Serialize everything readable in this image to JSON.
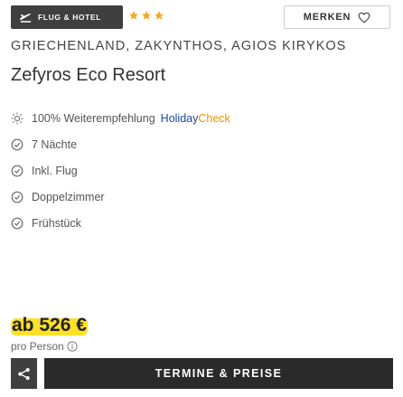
{
  "badge": {
    "label": "FLUG & HOTEL",
    "icon": "airplane-hotel-icon"
  },
  "rating": {
    "stars": 3,
    "color": "#f5a623"
  },
  "merken": {
    "label": "MERKEN",
    "icon": "heart-outline-icon"
  },
  "location": "GRIECHENLAND, ZAKYNTHOS, AGIOS KIRYKOS",
  "hotel_name": "Zefyros Eco Resort",
  "recommendation": {
    "text": "100% Weiterempfehlung",
    "logo_h": "Holiday",
    "logo_c": "Check",
    "icon": "sun-icon"
  },
  "features": [
    {
      "label": "7 Nächte",
      "icon": "check-circle-icon"
    },
    {
      "label": "Inkl. Flug",
      "icon": "check-circle-icon"
    },
    {
      "label": "Doppelzimmer",
      "icon": "check-circle-icon"
    },
    {
      "label": "Frühstück",
      "icon": "check-circle-icon"
    }
  ],
  "price": {
    "value": "ab 526 €",
    "highlight": "#ffe028"
  },
  "per_person": {
    "label": "pro Person",
    "icon": "info-icon"
  },
  "share": {
    "icon": "share-icon"
  },
  "cta": {
    "label": "TERMINE & PREISE"
  },
  "colors": {
    "dark": "#2a2a2a",
    "badge": "#3f3f3f",
    "accent_yellow": "#ffe028"
  }
}
